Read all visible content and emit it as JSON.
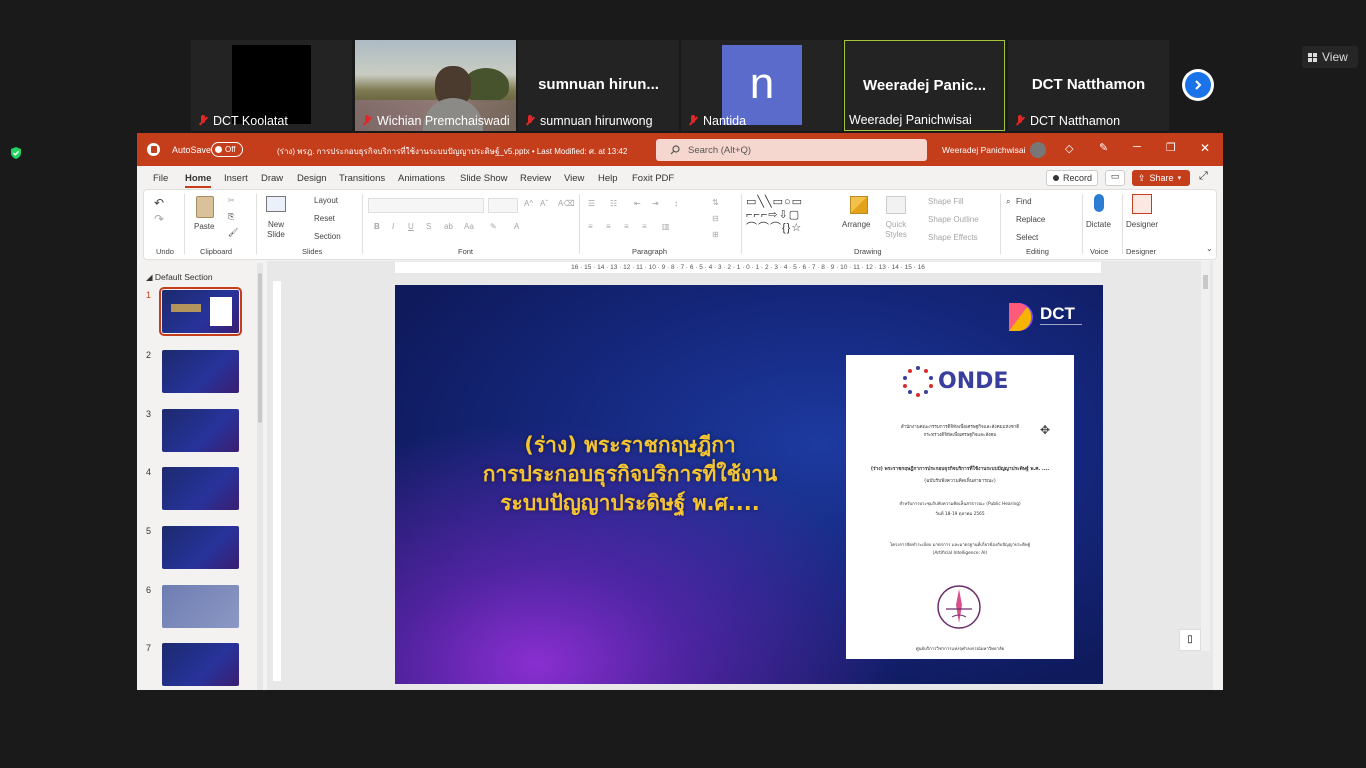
{
  "meeting": {
    "view_label": "View",
    "participants": [
      {
        "name": "DCT Koolatat",
        "video": "black"
      },
      {
        "name": "Wichian Premchaiswadi",
        "video": "camera"
      },
      {
        "name": "sumnuan hirunwong",
        "display": "sumnuan  hirun..."
      },
      {
        "name": "Nantida",
        "avatar": "n"
      },
      {
        "name": "Weeradej Panichwisai",
        "display": "Weeradej  Panic..."
      },
      {
        "name": "DCT Natthamon",
        "display": "DCT Natthamon"
      }
    ]
  },
  "ppt": {
    "autosave": "AutoSave",
    "autosave_state": "Off",
    "file_title": "(ร่าง) พรฎ. การประกอบธุรกิจบริการที่ใช้งานระบบปัญญาประดิษฐ์_v5.pptx • Last Modified: ศ. at 13:42",
    "search_placeholder": "Search (Alt+Q)",
    "user": "Weeradej Panichwisai",
    "tabs": [
      "File",
      "Home",
      "Insert",
      "Draw",
      "Design",
      "Transitions",
      "Animations",
      "Slide Show",
      "Review",
      "View",
      "Help",
      "Foxit PDF"
    ],
    "record": "Record",
    "share": "Share",
    "ribbon": {
      "undo": "Undo",
      "paste": "Paste",
      "clipboard": "Clipboard",
      "new_slide": "New Slide",
      "layout": "Layout",
      "reset": "Reset",
      "section": "Section",
      "slides": "Slides",
      "font": "Font",
      "paragraph": "Paragraph",
      "drawing": "Drawing",
      "arrange": "Arrange",
      "quick_styles": "Quick Styles",
      "shape_fill": "Shape Fill",
      "shape_outline": "Shape Outline",
      "shape_effects": "Shape Effects",
      "find": "Find",
      "replace": "Replace",
      "select": "Select",
      "editing": "Editing",
      "dictate": "Dictate",
      "voice": "Voice",
      "designer": "Designer",
      "designer_group": "Designer"
    },
    "section_name": "Default Section",
    "slide_numbers": [
      "1",
      "2",
      "3",
      "4",
      "5",
      "6",
      "7"
    ],
    "ruler": "16 · 15 · 14 · 13 · 12 · 11 · 10 · 9 · 8 · 7 · 6 · 5 · 4 · 3 · 2 · 1 · 0 · 1 · 2 · 3 · 4 · 5 · 6 · 7 · 8 · 9 · 10 · 11 · 12 · 13 · 14 · 15 · 16",
    "slide": {
      "title_line1": "(ร่าง) พระราชกฤษฎีกา",
      "title_line2": "การประกอบธุรกิจบริการที่ใช้งาน",
      "title_line3": "ระบบปัญญาประดิษฐ์ พ.ศ....",
      "logo": "DCT",
      "doc_logo": "ONDE",
      "doc_org": "สำนักงานคณะกรรมการดิจิทัลเพื่อเศรษฐกิจและสังคมแห่งชาติ",
      "doc_ministry": "กระทรวงดิจิทัลเพื่อเศรษฐกิจและสังคม",
      "doc_title": "(ร่าง) พระราชกฤษฎีกาการประกอบธุรกิจบริการที่ใช้งานระบบปัญญาประดิษฐ์ พ.ศ. ....",
      "doc_sub": "(ฉบับรับฟังความคิดเห็นสาธารณะ)",
      "doc_hearing": "สำหรับการประชุมรับฟังความคิดเห็นสาธารณะ (Public Hearing)",
      "doc_date": "วันที่ 18-19 ตุลาคม 2565",
      "doc_project": "โครงการจัดทำระเบียบ มาตรการ และมาตรฐานที่เกี่ยวข้องกับปัญญาประดิษฐ์",
      "doc_ai": "(Artificial Intelligence: AI)",
      "doc_footer": "ศูนย์บริการวิชาการแห่งจุฬาลงกรณ์มหาวิทยาลัย"
    }
  }
}
